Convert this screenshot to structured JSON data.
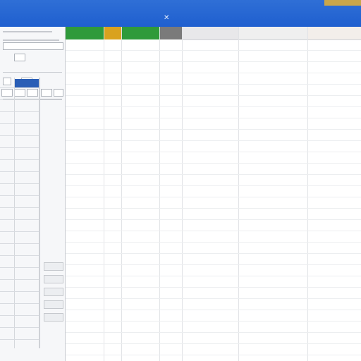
{
  "window": {
    "title": "",
    "close_glyph": "✕"
  },
  "left_pane": {
    "rows": [
      "",
      "",
      "",
      "",
      "",
      "",
      "",
      ""
    ],
    "chips": [
      "",
      "",
      "",
      "",
      ""
    ],
    "side_buttons": [
      "",
      "",
      "",
      "",
      ""
    ]
  },
  "grid": {
    "header_cells": [
      {
        "label": "",
        "color": "#2f9a3a"
      },
      {
        "label": "",
        "color": "#d9a21f"
      },
      {
        "label": "",
        "color": "#2f9a3a"
      },
      {
        "label": "",
        "color": "#7a7a7a"
      },
      {
        "label": "",
        "color": "#e8e8ea"
      },
      {
        "label": "",
        "color": "#efefef"
      },
      {
        "label": "",
        "color": "#f3eeea"
      }
    ],
    "rows": 28
  }
}
